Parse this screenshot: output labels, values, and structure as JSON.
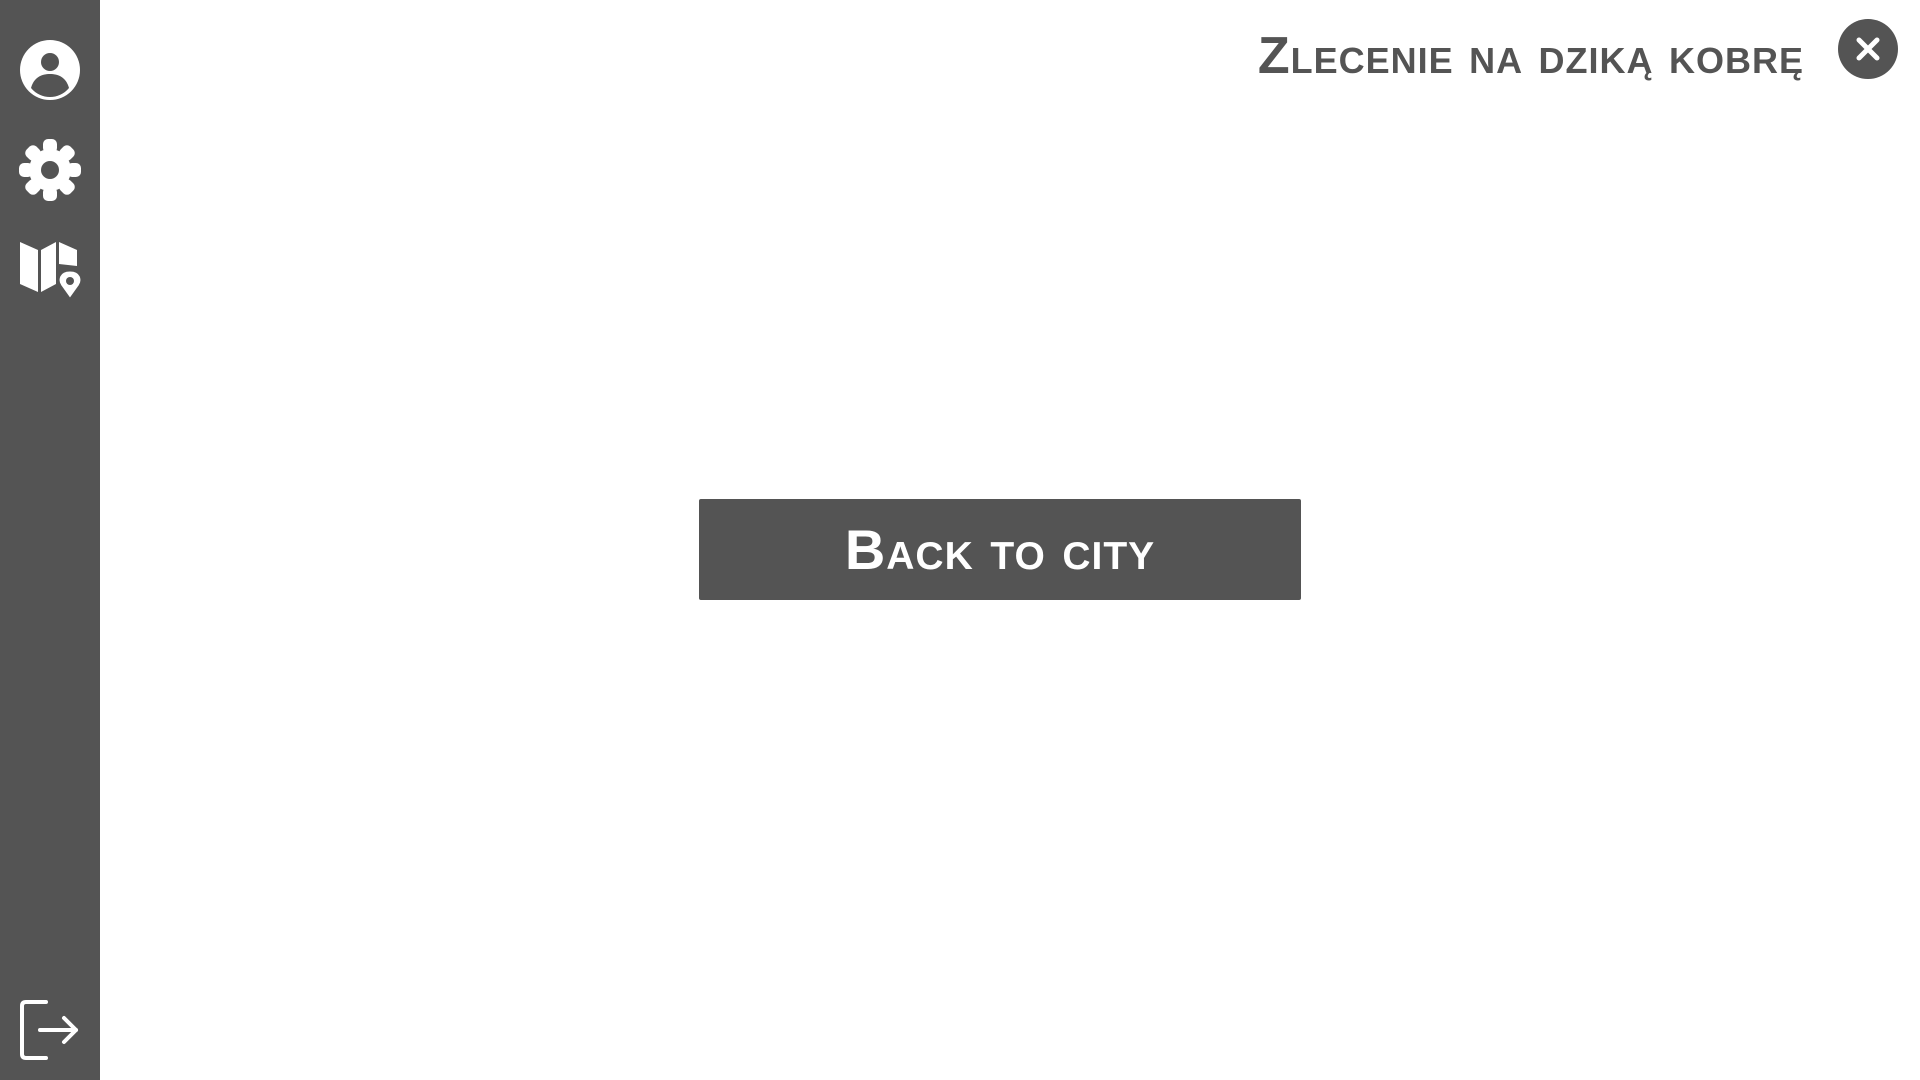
{
  "sidebar": {
    "items": [
      {
        "icon": "user-circle-icon",
        "label": ""
      },
      {
        "icon": "gear-icon",
        "label": ""
      },
      {
        "icon": "map-pin-icon",
        "label": ""
      }
    ],
    "logout_icon": "logout-icon"
  },
  "header": {
    "title": "Zlecenie na dziką kobrę",
    "close_icon": "close-icon"
  },
  "main": {
    "back_button_label": "Back to city"
  },
  "colors": {
    "accent": "#545454",
    "background": "#ffffff",
    "icon": "#ffffff"
  }
}
